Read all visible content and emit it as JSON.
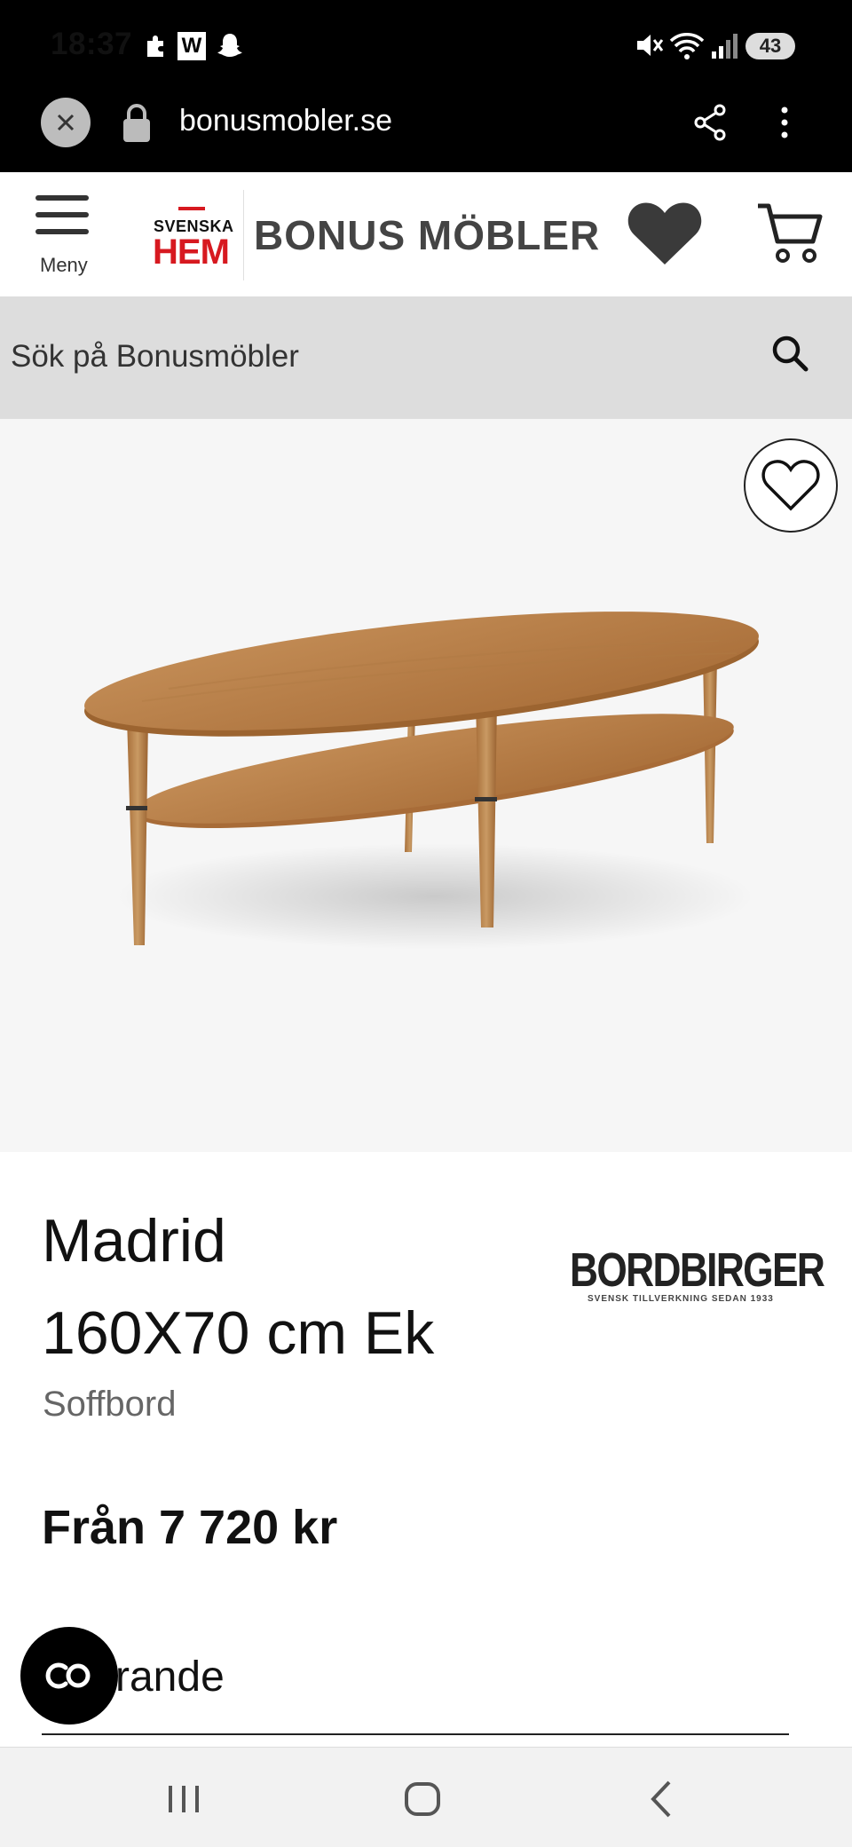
{
  "status_bar": {
    "time": "18:37",
    "battery": "43"
  },
  "browser": {
    "url": "bonusmobler.se"
  },
  "header": {
    "menu_label": "Meny",
    "logo_small": "SVENSKA",
    "logo_main": "HEM",
    "brand_name": "BONUS MÖBLER"
  },
  "search": {
    "placeholder": "Sök på Bonusmöbler"
  },
  "product": {
    "name": "Madrid",
    "size": "160X70 cm Ek",
    "category": "Soffbord",
    "brand_logo": "BORDBIRGER",
    "brand_tagline": "SVENSK TILLVERKNING SEDAN 1933",
    "price": "Från 7 720 kr",
    "variant_label": "rande"
  },
  "colors": {
    "accent_red": "#d71920",
    "search_bg": "#dddddd",
    "hero_bg": "#f6f6f6",
    "wood": "#b87d47"
  },
  "icons": [
    "close-icon",
    "lock-icon",
    "share-icon",
    "more-icon",
    "hamburger-icon",
    "heart-icon",
    "cart-icon",
    "search-icon",
    "chat-icon",
    "recent-apps-icon",
    "home-icon",
    "back-icon"
  ]
}
